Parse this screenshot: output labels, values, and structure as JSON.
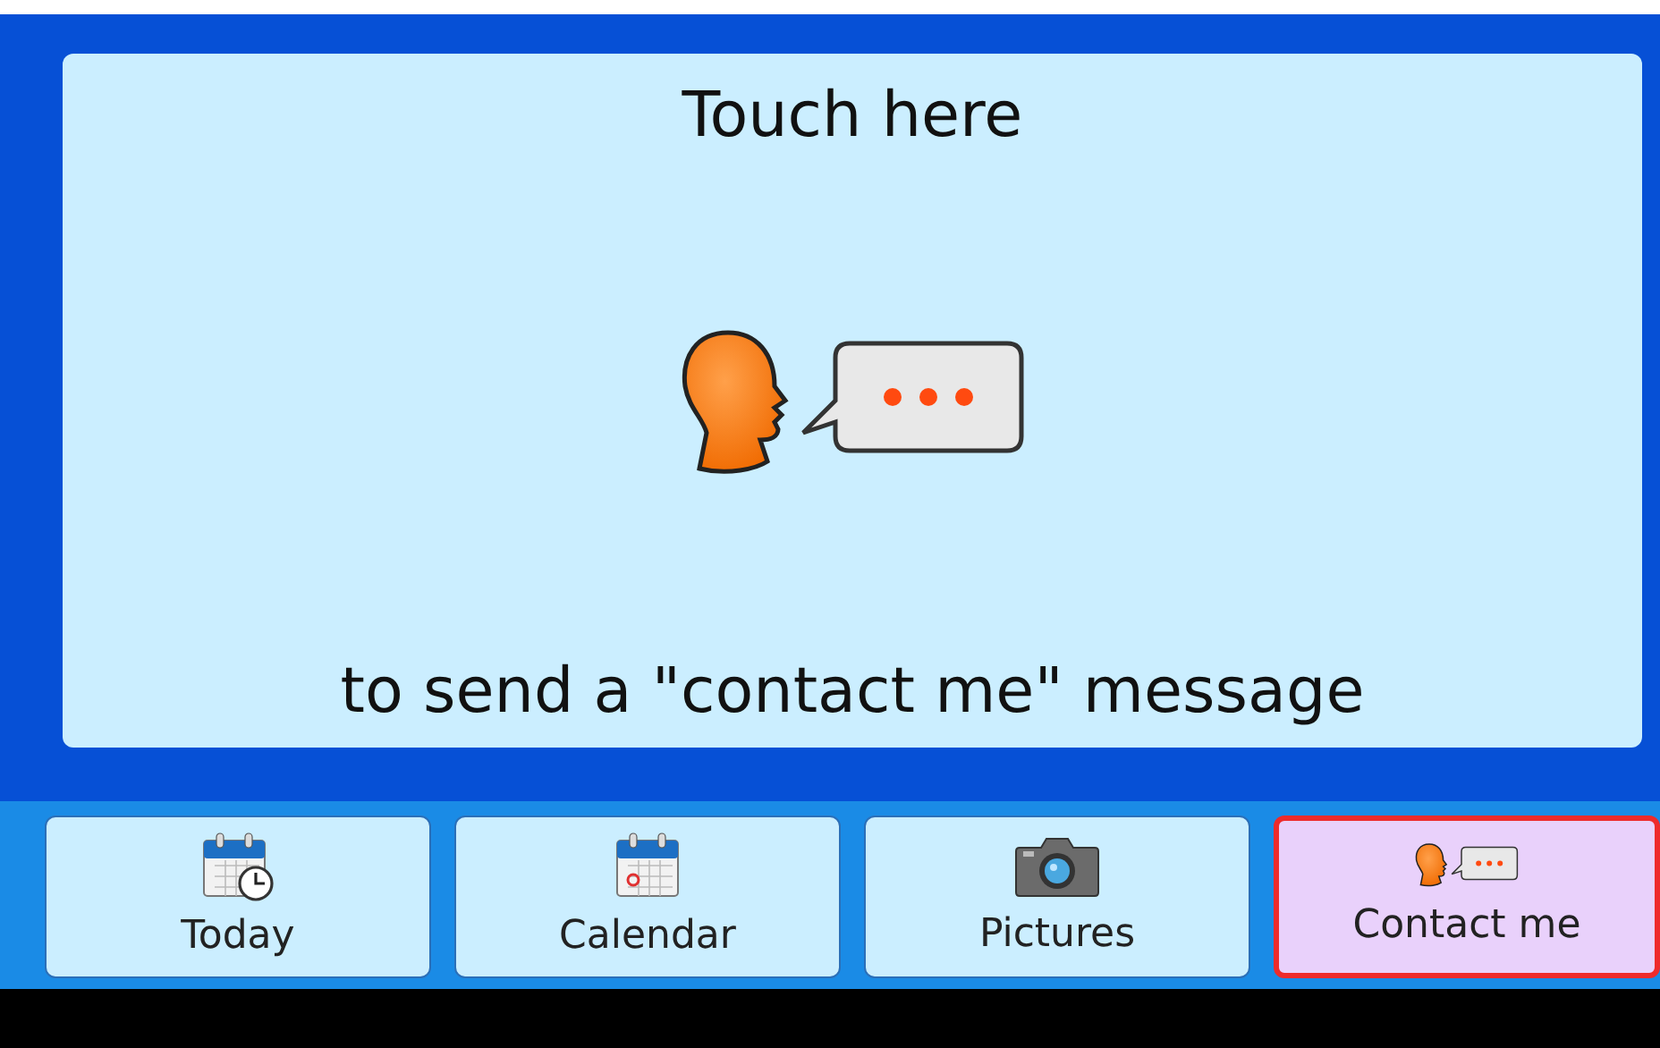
{
  "message_panel": {
    "title": "Touch here",
    "caption": "to send a \"contact me\" message"
  },
  "tabs": [
    {
      "label": "Today",
      "kind": "today",
      "selected": false
    },
    {
      "label": "Calendar",
      "kind": "calendar",
      "selected": false
    },
    {
      "label": "Pictures",
      "kind": "camera",
      "selected": false
    },
    {
      "label": "Contact me",
      "kind": "contact",
      "selected": true
    }
  ]
}
